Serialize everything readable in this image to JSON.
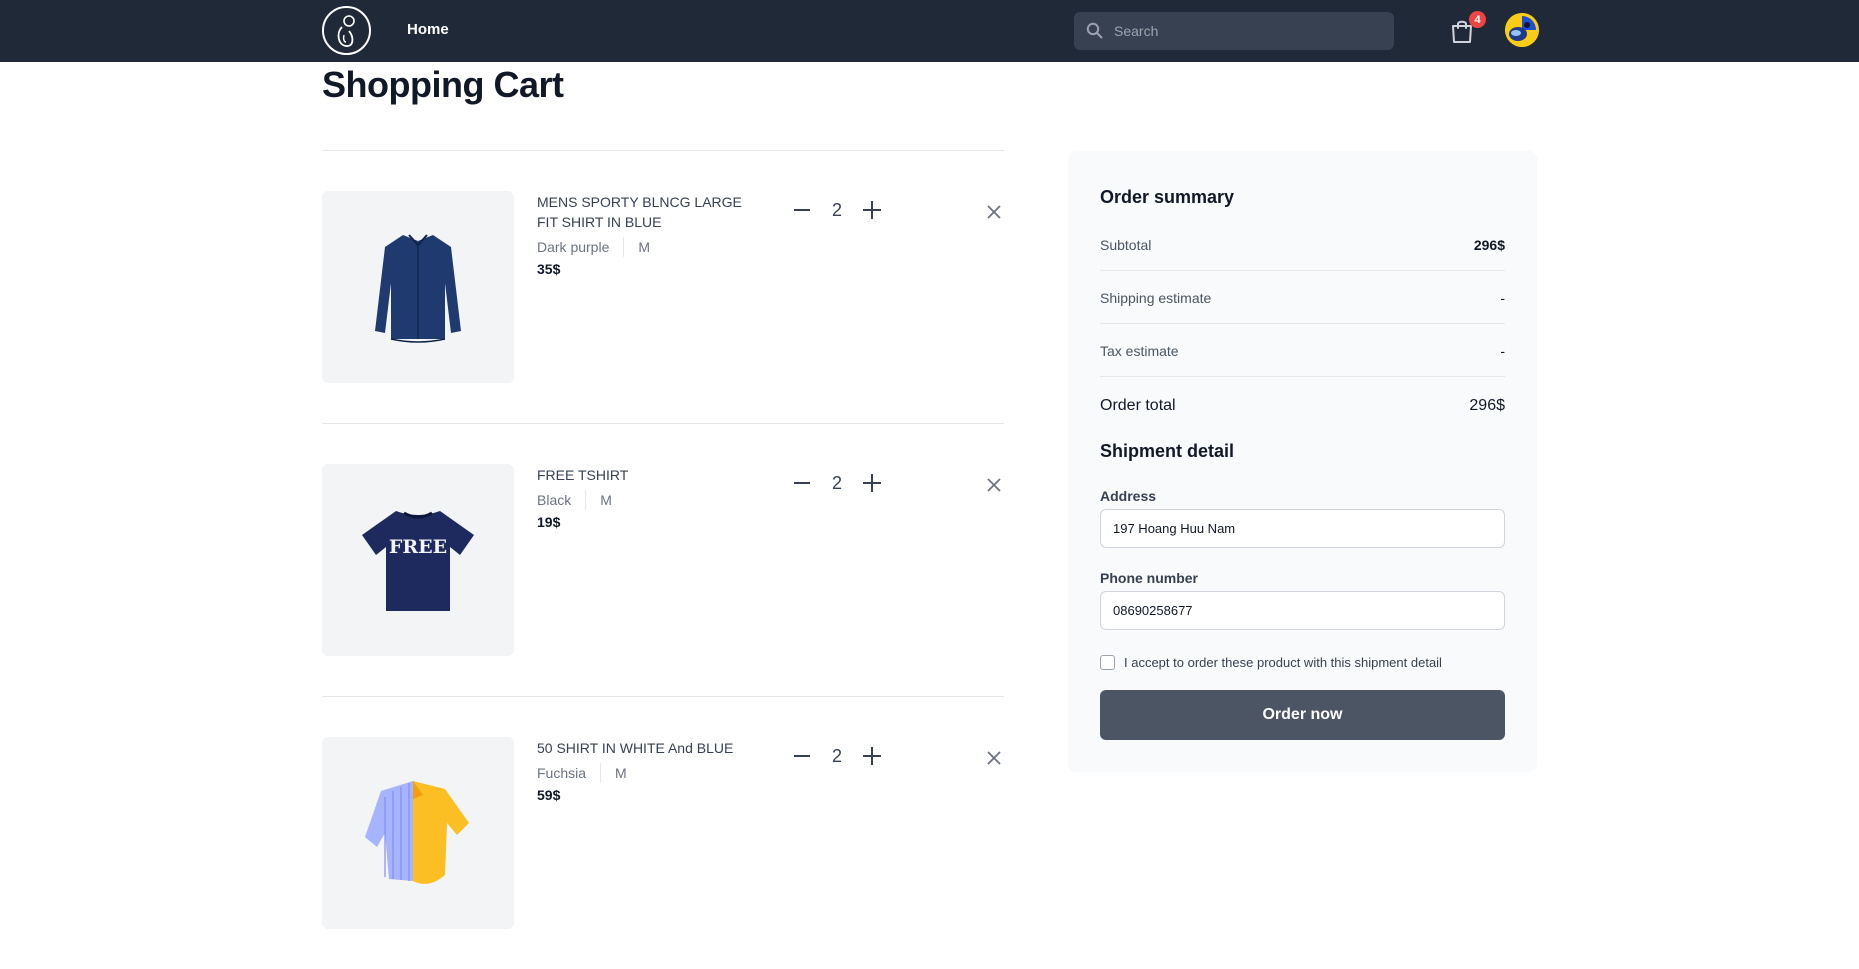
{
  "navbar": {
    "logo_icon": "logo-icon",
    "home_label": "Home",
    "search_placeholder": "Search",
    "search_icon": "search-icon",
    "cart_icon": "shopping-bag-icon",
    "cart_count": "4",
    "avatar_icon": "avatar"
  },
  "page": {
    "title": "Shopping Cart"
  },
  "cart": {
    "items": [
      {
        "name": "MENS SPORTY BLNCG LARGE FIT SHIRT IN BLUE",
        "color": "Dark purple",
        "size": "M",
        "price": "35$",
        "quantity": "2"
      },
      {
        "name": "FREE TSHIRT",
        "color": "Black",
        "size": "M",
        "price": "19$",
        "quantity": "2"
      },
      {
        "name": "50 SHIRT IN WHITE And BLUE",
        "color": "Fuchsia",
        "size": "M",
        "price": "59$",
        "quantity": "2"
      }
    ],
    "tshirt_print": "FREE"
  },
  "summary": {
    "title": "Order summary",
    "subtotal_label": "Subtotal",
    "subtotal_value": "296$",
    "shipping_label": "Shipping estimate",
    "shipping_value": "-",
    "tax_label": "Tax estimate",
    "tax_value": "-",
    "total_label": "Order total",
    "total_value": "296$"
  },
  "shipment": {
    "title": "Shipment detail",
    "address_label": "Address",
    "address_value": "197 Hoang Huu Nam",
    "phone_label": "Phone number",
    "phone_value": "08690258677",
    "agree_label": "I accept to order these product with this shipment detail",
    "order_button": "Order now"
  },
  "colors": {
    "navbar_bg": "#1f2937",
    "badge": "#ef4444",
    "order_button_bg": "#4b5563"
  }
}
